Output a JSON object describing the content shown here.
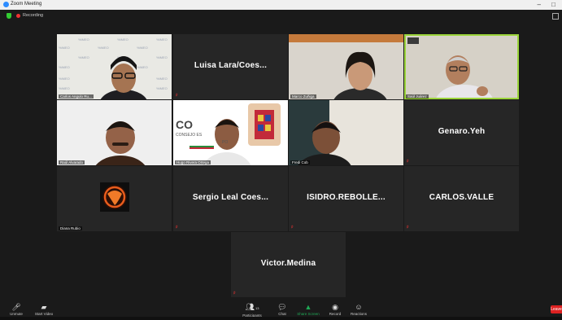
{
  "window": {
    "title": "Zoom Meeting",
    "minimize": "–",
    "close": "□"
  },
  "recording": {
    "label": "Recording"
  },
  "participants": [
    {
      "id": "p1",
      "label": "Carlos Angulo Ru...",
      "kind": "video",
      "bg": "#e9e9e4"
    },
    {
      "id": "p2",
      "name": "Luisa Lara/Coes...",
      "kind": "name"
    },
    {
      "id": "p3",
      "label": "Marco Zuñiga",
      "kind": "video",
      "bg": "#ccc7bf"
    },
    {
      "id": "p4",
      "label": "Saúl Juárez",
      "kind": "video",
      "bg": "#cfcac0",
      "active": true
    },
    {
      "id": "p5",
      "label": "Raúl Alvarado",
      "kind": "video",
      "bg": "#efefef"
    },
    {
      "id": "p6",
      "label": "Hugo Rivera Ortega",
      "kind": "video",
      "bg": "#ffffff",
      "banner": "CO",
      "banner_sub": "CONSEJO ES",
      "banner_sub2": "PO"
    },
    {
      "id": "p7",
      "label": "Fredi Cob",
      "kind": "video",
      "bg": "#2f2c29"
    },
    {
      "id": "p8",
      "name": "Genaro.Yeh",
      "kind": "name"
    },
    {
      "id": "p9",
      "label": "Diana Rubio",
      "kind": "avatar"
    },
    {
      "id": "p10",
      "name": "Sergio Leal Coes...",
      "kind": "name"
    },
    {
      "id": "p11",
      "name": "ISIDRO.REBOLLE...",
      "kind": "name"
    },
    {
      "id": "p12",
      "name": "CARLOS.VALLE",
      "kind": "name"
    },
    {
      "id": "p13",
      "name": "Victor.Medina",
      "kind": "name"
    }
  ],
  "toolbar": {
    "unmute": "Unmute",
    "start_video": "Start Video",
    "participants": "Participants",
    "participants_count": "13",
    "chat": "Chat",
    "share_screen": "Share Screen",
    "record": "Record",
    "reactions": "Reactions",
    "leave": "Leave"
  },
  "colors": {
    "active_border": "#9bd43a",
    "share": "#1fa855",
    "leave": "#dd2222",
    "background": "#1a1a1a"
  }
}
